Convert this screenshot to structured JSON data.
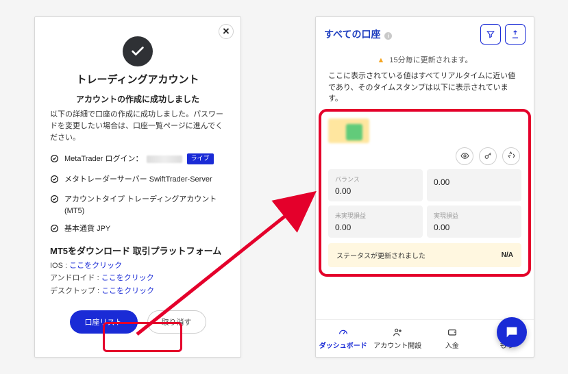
{
  "modal": {
    "title": "トレーディングアカウント",
    "subtitle": "アカウントの作成に成功しました",
    "description": "以下の詳細で口座の作成に成功しました。パスワードを変更したい場合は、口座一覧ページに進んでください。",
    "details": {
      "login_label": "MetaTrader ログイン：",
      "login_badge": "ライブ",
      "server_label": "メタトレーダーサーバー",
      "server_value": "SwiftTrader-Server",
      "account_type_label": "アカウントタイプ",
      "account_type_value": "トレーディングアカウント (MT5)",
      "base_currency_label": "基本通貨",
      "base_currency_value": "JPY"
    },
    "download": {
      "heading": "MT5をダウンロード 取引プラットフォーム",
      "ios_label": "IOS :",
      "android_label": "アンドロイド :",
      "desktop_label": "デスクトップ :",
      "link_text": "ここをクリック"
    },
    "buttons": {
      "primary": "口座リスト",
      "cancel": "取り消す"
    }
  },
  "accounts": {
    "header_title": "すべての口座",
    "refresh_note": "15分毎に更新されます。",
    "explain": "ここに表示されている値はすべてリアルタイムに近い値であり、そのタイムスタンプは以下に表示されています。",
    "stats": [
      {
        "label": "バランス",
        "value": "0.00"
      },
      {
        "label": "",
        "value": "0.00"
      },
      {
        "label": "未実現損益",
        "value": "0.00"
      },
      {
        "label": "実現損益",
        "value": "0.00"
      }
    ],
    "status_label": "ステータスが更新されました",
    "status_value": "N/A",
    "nav": {
      "dashboard": "ダッシュボード",
      "open": "アカウント開設",
      "deposit": "入金",
      "more": "もっ"
    }
  }
}
